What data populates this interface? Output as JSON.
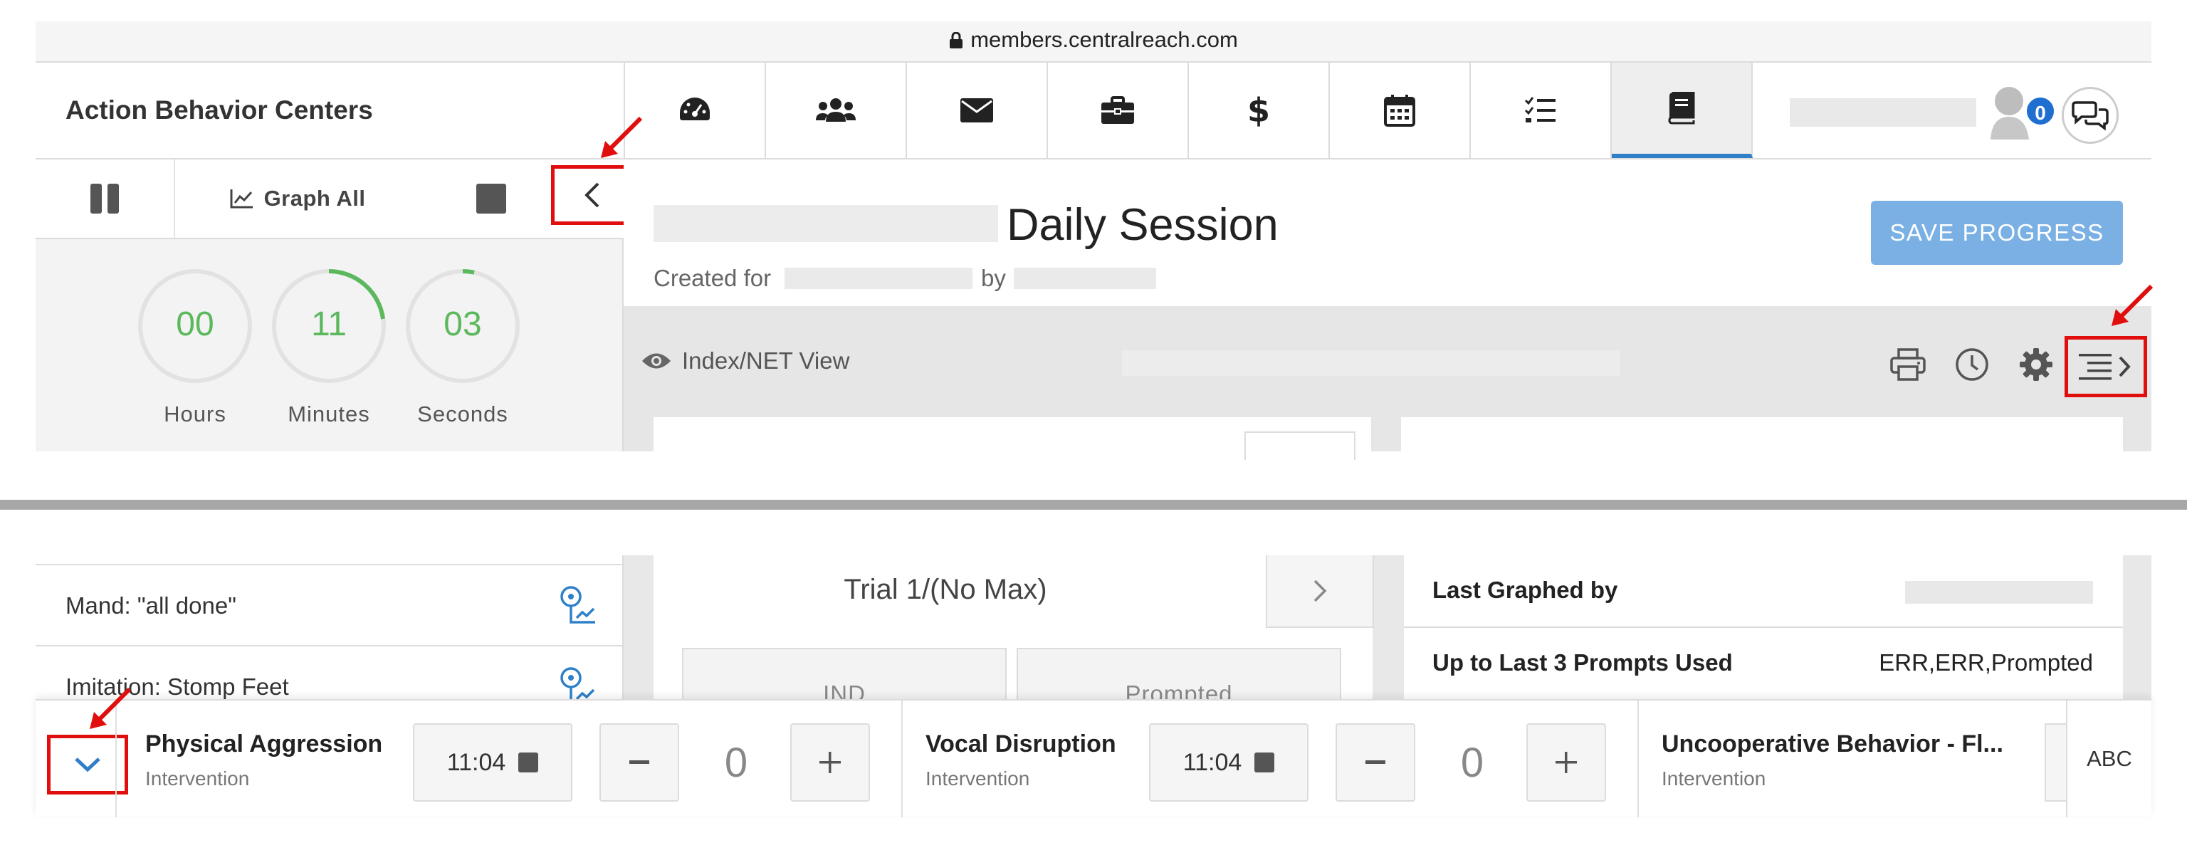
{
  "browser": {
    "url": "members.centralreach.com",
    "lock_icon": "lock-icon"
  },
  "header": {
    "org_name": "Action Behavior Centers",
    "nav_tabs": [
      {
        "icon": "dashboard-icon",
        "active": false
      },
      {
        "icon": "users-icon",
        "active": false
      },
      {
        "icon": "envelope-icon",
        "active": false
      },
      {
        "icon": "briefcase-icon",
        "active": false
      },
      {
        "icon": "dollar-icon",
        "active": false
      },
      {
        "icon": "calendar-icon",
        "active": false
      },
      {
        "icon": "task-list-icon",
        "active": false
      },
      {
        "icon": "book-icon",
        "active": true
      }
    ],
    "notification_count": "0",
    "avatar_icon": "avatar-icon",
    "chat_icon": "chat-bubbles-icon"
  },
  "session_controls": {
    "graph_all_label": "Graph All",
    "timer": {
      "hours": "00",
      "minutes": "11",
      "seconds": "03",
      "hours_label": "Hours",
      "minutes_label": "Minutes",
      "seconds_label": "Seconds"
    },
    "accent_color": "#5cb85c"
  },
  "session": {
    "title": "Daily Session",
    "created_for_label": "Created for",
    "by_label": "by",
    "save_button": "SAVE PROGRESS",
    "view_label": "Index/NET View"
  },
  "targets": [
    {
      "label": "Mand: \"all done\""
    },
    {
      "label": "Imitation: Stomp Feet"
    }
  ],
  "trial": {
    "label": "Trial 1/(No Max)",
    "prompt_buttons": [
      "IND",
      "Prompted"
    ]
  },
  "info": [
    {
      "key": "Last Graphed by",
      "value": ""
    },
    {
      "key": "Up to Last 3 Prompts Used",
      "value": "ERR,ERR,Prompted"
    }
  ],
  "behaviors": [
    {
      "name": "Physical Aggression",
      "type": "Intervention",
      "timer": "11:04",
      "count": "0"
    },
    {
      "name": "Vocal Disruption",
      "type": "Intervention",
      "timer": "11:04",
      "count": "0"
    },
    {
      "name": "Uncooperative Behavior - Fl...",
      "type": "Intervention"
    }
  ],
  "abc_label": "ABC",
  "colors": {
    "annotation": "#e10e0e",
    "primary": "#2f80c9",
    "save_button": "#7ab0e3"
  }
}
